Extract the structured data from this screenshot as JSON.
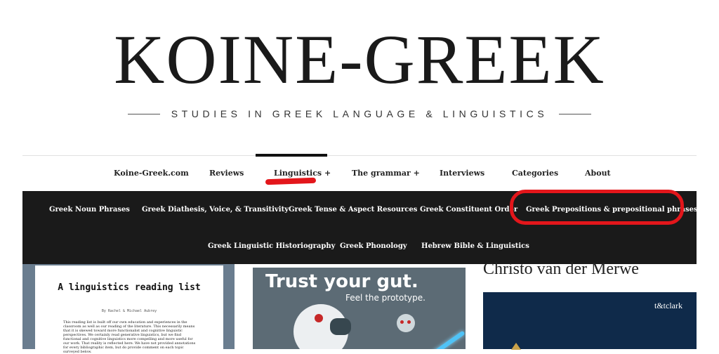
{
  "site": {
    "title": "KOINE-GREEK",
    "tagline": "STUDIES IN GREEK LANGUAGE & LINGUISTICS"
  },
  "nav": {
    "items": [
      {
        "label": "Koine-Greek.com"
      },
      {
        "label": "Reviews"
      },
      {
        "label": "Linguistics +"
      },
      {
        "label": "The grammar +"
      },
      {
        "label": "Interviews"
      },
      {
        "label": "Categories"
      },
      {
        "label": "About"
      }
    ],
    "active": "Linguistics +"
  },
  "dropdown": {
    "row1": [
      {
        "label": "Greek Noun Phrases"
      },
      {
        "label": "Greek Diathesis, Voice, & Transitivity"
      },
      {
        "label": "Greek Tense & Aspect Resources"
      },
      {
        "label": "Greek Constituent Order"
      },
      {
        "label": "Greek Prepositions & prepositional phrases"
      }
    ],
    "row2": [
      {
        "label": "Greek Linguistic Historiography"
      },
      {
        "label": "Greek Phonology"
      },
      {
        "label": "Hebrew Bible & Linguistics"
      }
    ]
  },
  "content": {
    "reading_list": {
      "title": "A linguistics reading list",
      "authors": "By Rachel & Michael Aubrey",
      "body": "This reading list is built off our own education and experiences in the classroom as well as our reading of the literature. This necessarily means that it is skewed toward more functionalist and cognitive linguistic perspectives. We certainly read generative linguistics, but we find functional and cognitive linguistics more compelling and more useful for our work. That reality is reflected here. We have not provided annotations for every bibliographic item, but do provide comment on each topic surveyed below."
    },
    "ad": {
      "title": "Trust your gut.",
      "subtitle": "Feel the prototype."
    },
    "sidebar": {
      "author": "Christo van der Merwe",
      "publisher": "t&tclark"
    }
  },
  "colors": {
    "dropdown_bg": "#1a1a1a",
    "annotation_red": "#e3161b",
    "book_ad_bg": "#0f2a4a"
  }
}
